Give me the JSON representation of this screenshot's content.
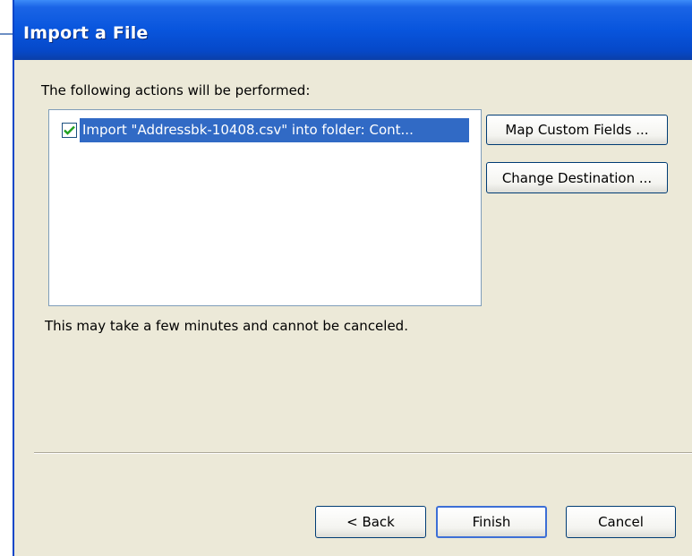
{
  "window": {
    "title": "Import a File"
  },
  "content": {
    "actions_label": "The following actions will be performed:",
    "actions_list": [
      {
        "checked": true,
        "text": "Import \"Addressbk-10408.csv\" into folder: Cont..."
      }
    ],
    "note": "This may take a few minutes and cannot be canceled."
  },
  "buttons": {
    "map_custom_fields": "Map Custom Fields ...",
    "change_destination": "Change Destination ...",
    "back": "< Back",
    "finish": "Finish",
    "cancel": "Cancel"
  },
  "colors": {
    "titlebar": "#0855dd",
    "dialog_bg": "#ece9d8",
    "selection": "#316ac5"
  },
  "icons": {
    "checkbox_checked": "checkmark-icon"
  }
}
